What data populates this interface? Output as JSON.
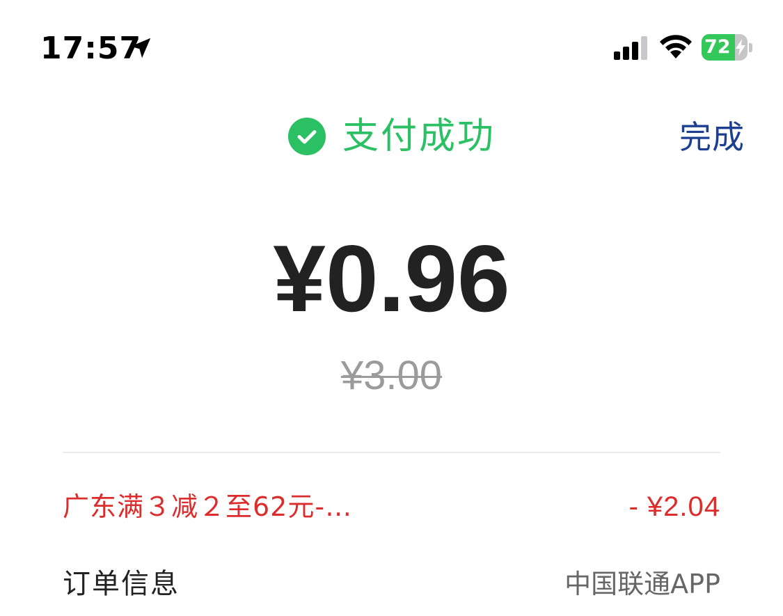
{
  "status_bar": {
    "time": "17:57",
    "battery_level": "72",
    "battery_fraction": 0.72,
    "icons": [
      "location-arrow-icon",
      "signal-icon",
      "wifi-icon",
      "battery-charging-icon"
    ],
    "colors": {
      "battery_green": "#34c759"
    }
  },
  "header": {
    "title": "支付成功",
    "done_label": "完成",
    "icon": "check-circle-icon",
    "colors": {
      "success": "#2bc063",
      "done": "#1c3f94"
    }
  },
  "payment": {
    "paid_amount": "¥0.96",
    "original_amount": "¥3.00"
  },
  "discount": {
    "label": "广东满３减２至62元-…",
    "value": "- ¥2.04",
    "color": "#dd2c2c"
  },
  "order_info": {
    "label": "订单信息",
    "value": "中国联通APP"
  }
}
